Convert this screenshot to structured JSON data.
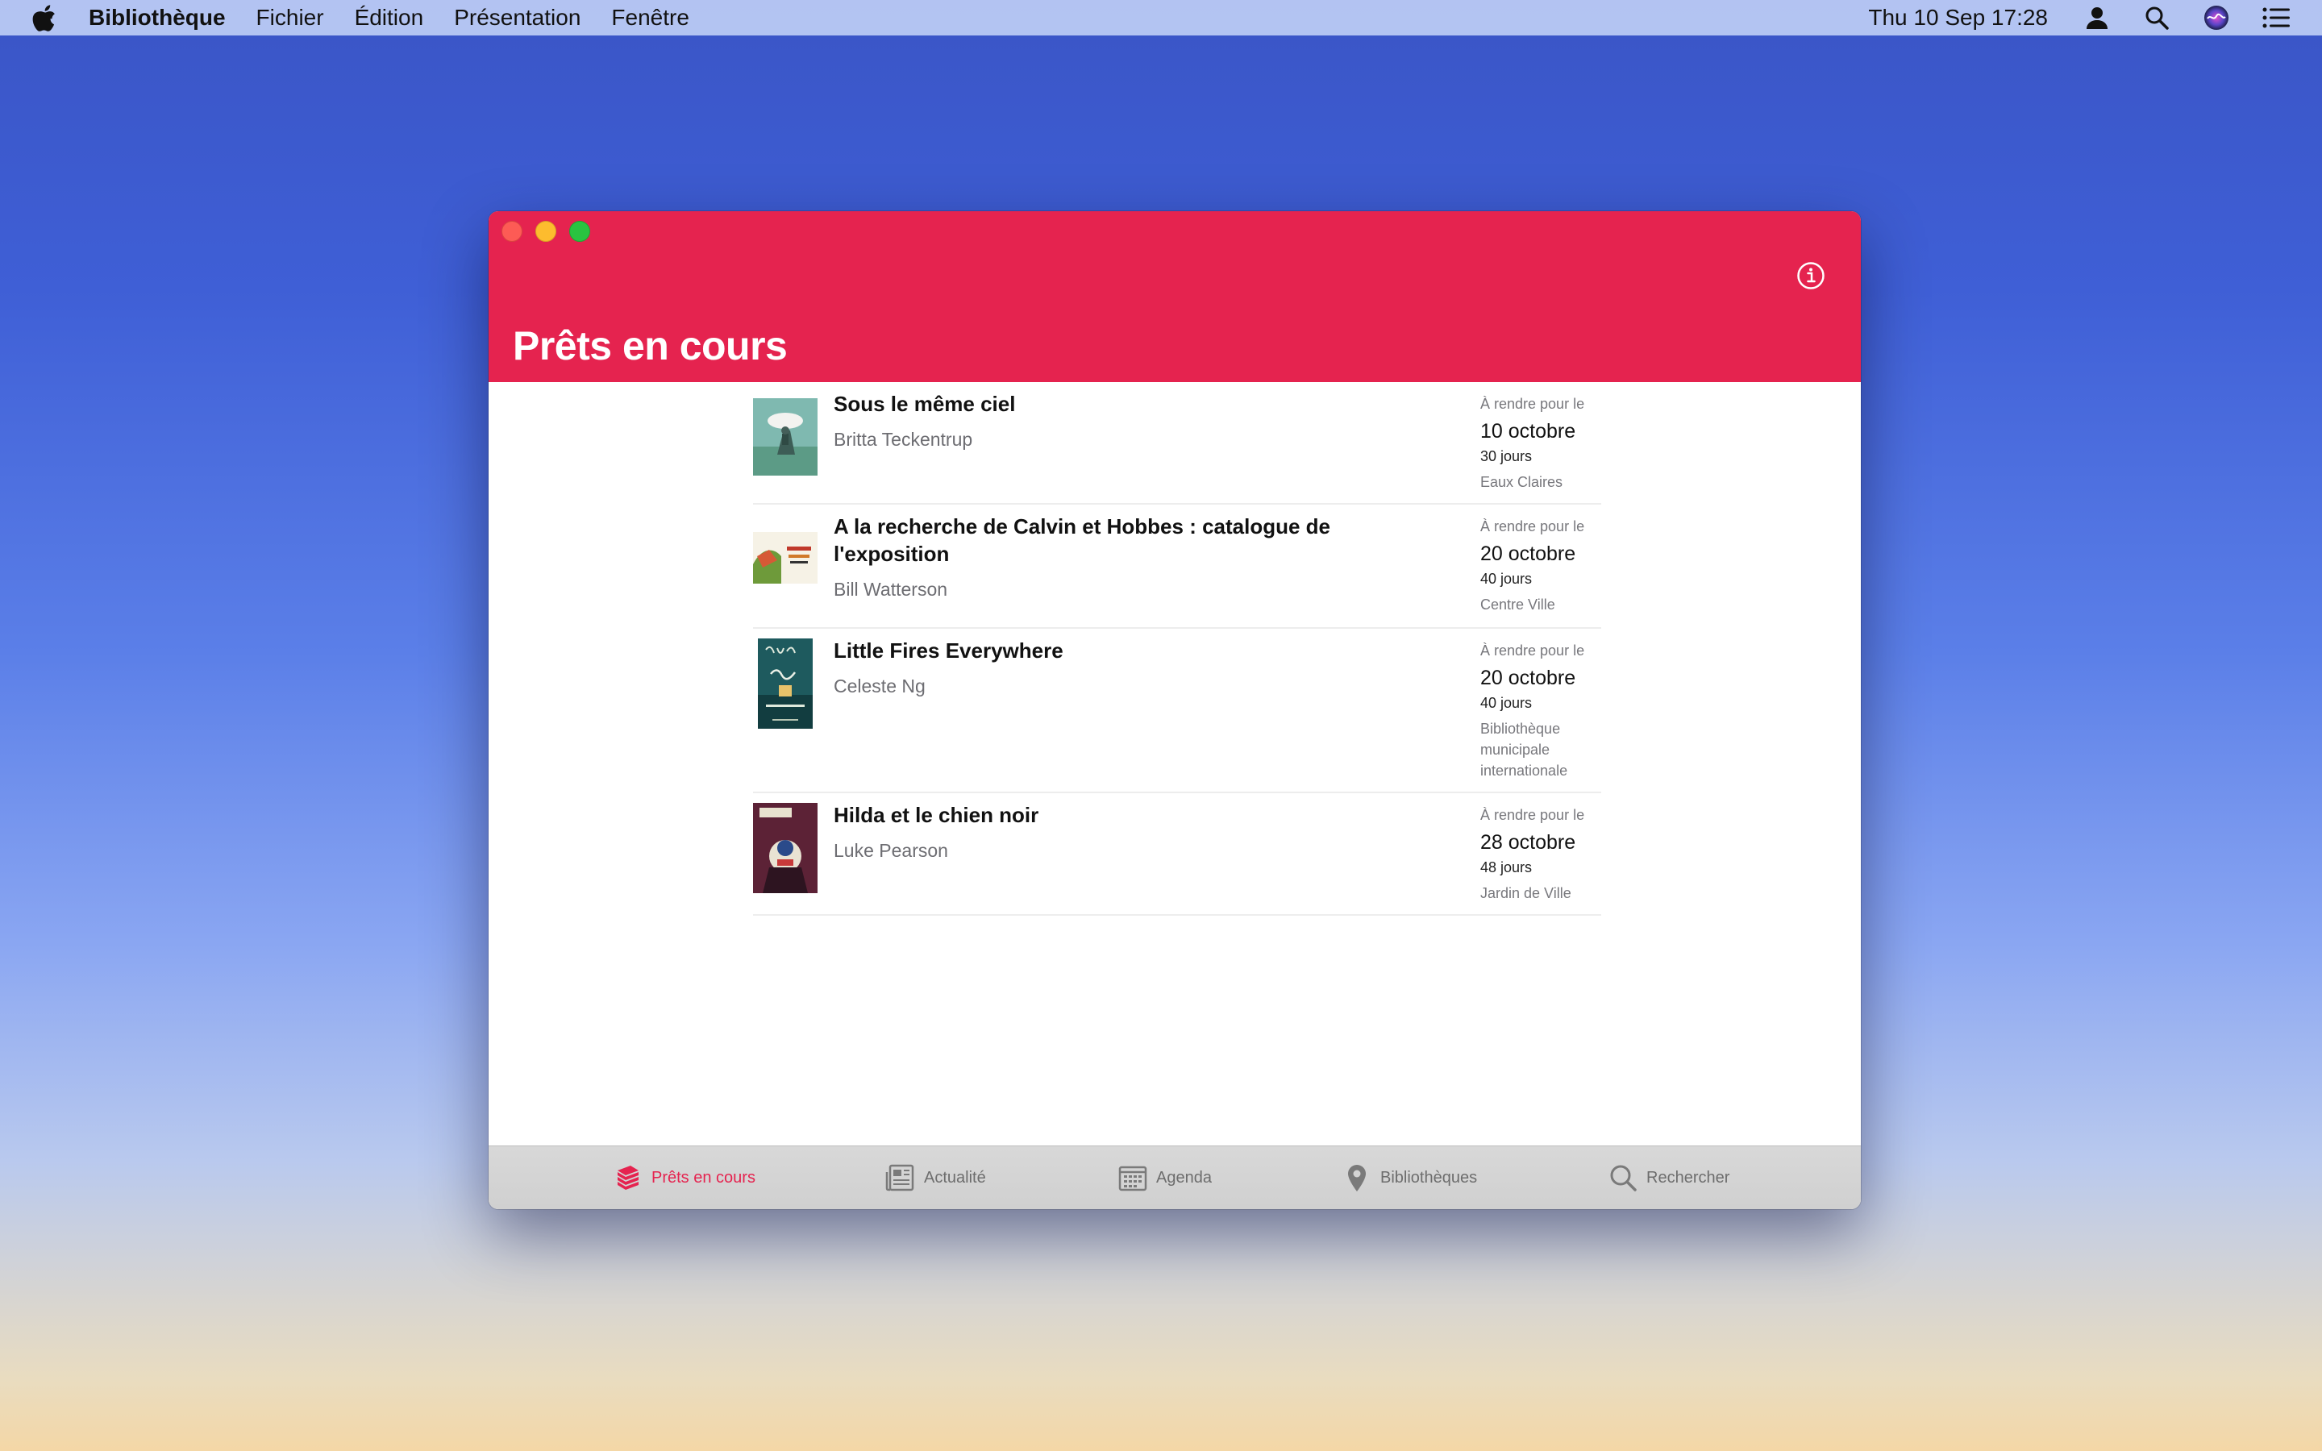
{
  "menubar": {
    "app_name": "Bibliothèque",
    "menus": [
      "Fichier",
      "Édition",
      "Présentation",
      "Fenêtre"
    ],
    "clock": "Thu 10 Sep  17:28"
  },
  "window": {
    "title": "Prêts en cours",
    "header_color": "#e5234f"
  },
  "loans": [
    {
      "title": "Sous le même ciel",
      "author": "Britta Teckentrup",
      "due_label": "À rendre pour le",
      "due_date": "10 octobre",
      "days": "30 jours",
      "library": "Eaux Claires"
    },
    {
      "title": "A la recherche de Calvin et Hobbes : catalogue de l'exposition",
      "author": "Bill Watterson",
      "due_label": "À rendre pour le",
      "due_date": "20 octobre",
      "days": "40 jours",
      "library": "Centre Ville"
    },
    {
      "title": "Little Fires Everywhere",
      "author": "Celeste Ng",
      "due_label": "À rendre pour le",
      "due_date": "20 octobre",
      "days": "40 jours",
      "library": "Bibliothèque municipale internationale"
    },
    {
      "title": "Hilda et le chien noir",
      "author": "Luke Pearson",
      "due_label": "À rendre pour le",
      "due_date": "28 octobre",
      "days": "48 jours",
      "library": "Jardin de Ville"
    }
  ],
  "tabs": [
    {
      "label": "Prêts en cours",
      "icon": "stack-books-icon",
      "active": true
    },
    {
      "label": "Actualité",
      "icon": "newspaper-icon",
      "active": false
    },
    {
      "label": "Agenda",
      "icon": "calendar-icon",
      "active": false
    },
    {
      "label": "Bibliothèques",
      "icon": "map-pin-icon",
      "active": false
    },
    {
      "label": "Rechercher",
      "icon": "search-icon",
      "active": false
    }
  ]
}
